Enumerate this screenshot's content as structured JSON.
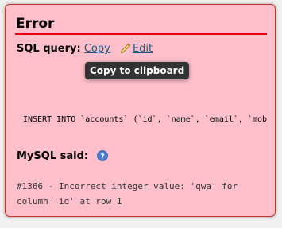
{
  "error": {
    "title": "Error",
    "sql_query_label": "SQL query:",
    "copy_link": "Copy",
    "edit_link": "Edit",
    "tooltip": "Copy to clipboard",
    "sql_text": "INSERT INTO `accounts` (`id`, `name`, `email`, `mob",
    "mysql_said_label": "MySQL said:",
    "message_line1": "#1366 - Incorrect integer value: 'qwa' for",
    "message_line2": "column 'id' at row 1"
  },
  "colors": {
    "panel_background": "#ffc0cb",
    "title_rule": "#e1000e",
    "link": "#235a81",
    "tooltip_background": "#333333"
  },
  "icons": {
    "edit": "pencil-icon",
    "help": "help-icon"
  }
}
